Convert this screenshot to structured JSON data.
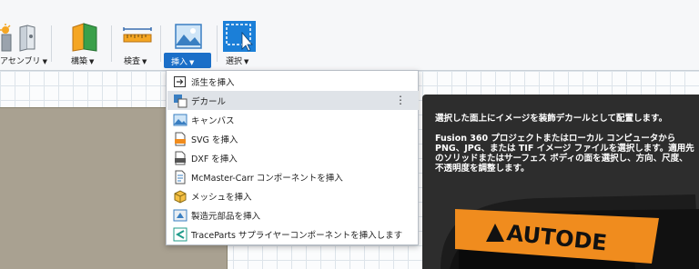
{
  "toolbar": {
    "groups": [
      {
        "label": "アセンブリ",
        "icon": "assembly-icon"
      },
      {
        "label": "構築",
        "icon": "construct-icon"
      },
      {
        "label": "検査",
        "icon": "measure-icon"
      },
      {
        "label": "挿入",
        "icon": "insert-image-icon",
        "active": true
      },
      {
        "label": "選択",
        "icon": "select-icon"
      }
    ],
    "caret": "▼"
  },
  "insert_menu": {
    "items": [
      {
        "label": "派生を挿入",
        "icon": "derive-icon"
      },
      {
        "label": "デカール",
        "icon": "decal-icon",
        "highlighted": true
      },
      {
        "label": "キャンバス",
        "icon": "canvas-icon"
      },
      {
        "label": "SVG を挿入",
        "icon": "svg-file-icon"
      },
      {
        "label": "DXF を挿入",
        "icon": "dxf-file-icon"
      },
      {
        "label": "McMaster-Carr コンポーネントを挿入",
        "icon": "mcmaster-icon"
      },
      {
        "label": "メッシュを挿入",
        "icon": "mesh-icon"
      },
      {
        "label": "製造元部品を挿入",
        "icon": "manufacturer-part-icon"
      },
      {
        "label": "TraceParts サプライヤーコンポーネントを挿入します",
        "icon": "traceparts-icon"
      }
    ],
    "more_glyph": "⋮"
  },
  "tooltip": {
    "title": "選択した面上にイメージを装飾デカールとして配置します。",
    "body": "Fusion 360 プロジェクトまたはローカル コンピュータから PNG、JPG、または TIF イメージ ファイルを選択します。適用先のソリッドまたはサーフェス ボディの面を選択し、方向、尺度、不透明度を調整します。",
    "preview_text": "AUTODE"
  },
  "colors": {
    "accent": "#1b6fc8",
    "tooltip_bg": "#2d2d2d",
    "menu_hover": "#dfe3e8",
    "preview_orange": "#f08c1e"
  }
}
